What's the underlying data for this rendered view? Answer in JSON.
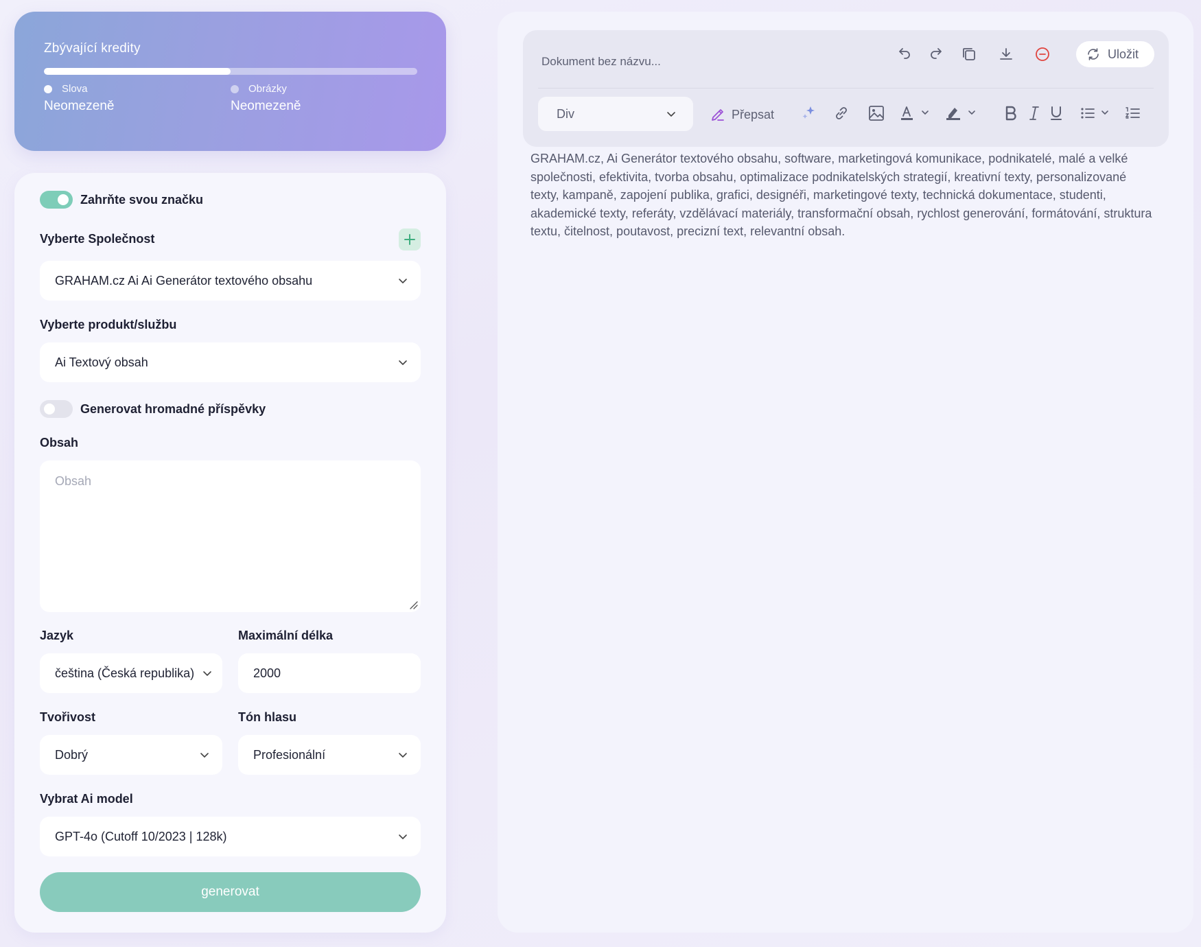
{
  "credits": {
    "title": "Zbývající kredity",
    "progress_fraction": 0.5,
    "words": {
      "label": "Slova",
      "value": "Neomezeně"
    },
    "images": {
      "label": "Obrázky",
      "value": "Neomezeně"
    }
  },
  "form": {
    "brand_toggle": {
      "label": "Zahrňte svou značku",
      "on": true
    },
    "company": {
      "label": "Vyberte Společnost",
      "value": "GRAHAM.cz Ai Ai Generátor textového obsahu"
    },
    "product": {
      "label": "Vyberte produkt/službu",
      "value": "Ai Textový obsah"
    },
    "bulk_toggle": {
      "label": "Generovat hromadné příspěvky",
      "on": false
    },
    "content": {
      "label": "Obsah",
      "placeholder": "Obsah",
      "value": ""
    },
    "language": {
      "label": "Jazyk",
      "value": "čeština (Česká republika)"
    },
    "max_length": {
      "label": "Maximální délka",
      "value": "2000"
    },
    "creativity": {
      "label": "Tvořivost",
      "value": "Dobrý"
    },
    "tone": {
      "label": "Tón hlasu",
      "value": "Profesionální"
    },
    "model": {
      "label": "Vybrat Ai model",
      "value": "GPT-4o (Cutoff 10/2023 | 128k)"
    },
    "generate_label": "generovat"
  },
  "editor": {
    "doc_title": "Dokument bez názvu...",
    "save_label": "Uložit",
    "block_select": "Div",
    "rewrite_label": "Přepsat",
    "icons": [
      "undo-icon",
      "redo-icon",
      "copy-icon",
      "download-icon",
      "delete-icon",
      "refresh-icon",
      "sparkle-icon",
      "link-icon",
      "image-icon",
      "text-color-icon",
      "highlight-icon",
      "bold-icon",
      "italic-icon",
      "underline-icon",
      "bullet-list-icon",
      "numbered-list-icon"
    ],
    "body_text": "GRAHAM.cz, Ai Generátor textového obsahu, software, marketingová komunikace, podnikatelé, malé a velké společnosti, efektivita, tvorba obsahu, optimalizace podnikatelských strategií, kreativní texty, personalizované texty, kampaně, zapojení publika, grafici, designéři, marketingové texty, technická dokumentace, studenti, akademické texty, referáty, vzdělávací materiály, transformační obsah, rychlost generování, formátování, struktura textu, čitelnost, poutavost, precizní text, relevantní obsah."
  },
  "colors": {
    "accent_green": "#7ecdb8",
    "generate_button": "#88cbbc",
    "credits_gradient_start": "#8ba6d9",
    "credits_gradient_end": "#a898ea",
    "delete_red": "#e0443e",
    "rewrite_purple": "#9b4fd6",
    "sparkle_blue": "#7b8fe0"
  }
}
